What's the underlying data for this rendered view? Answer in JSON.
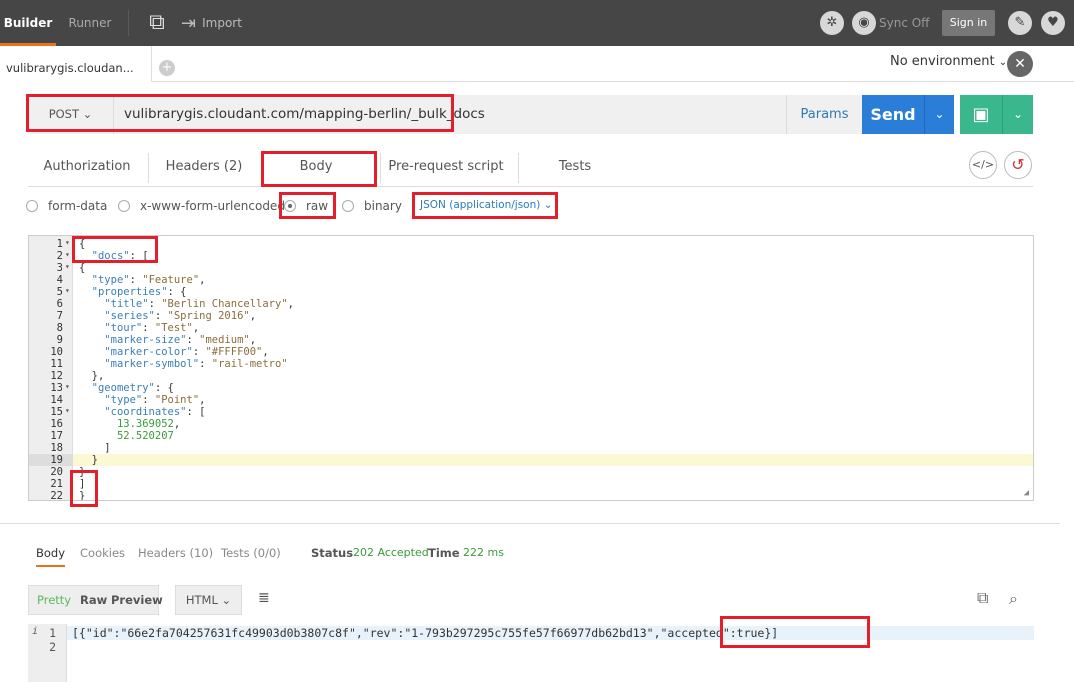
{
  "topbar": {
    "builder": "Builder",
    "runner": "Runner",
    "import": "Import",
    "sync": "Sync Off",
    "signin": "Sign in"
  },
  "tab": {
    "title": "vulibrarygis.cloudan..."
  },
  "environment": {
    "label": "No environment"
  },
  "request": {
    "method": "POST",
    "url": "vulibrarygis.cloudant.com/mapping-berlin/_bulk_docs",
    "params": "Params",
    "send": "Send"
  },
  "subtabs": [
    "Authorization",
    "Headers (2)",
    "Body",
    "Pre-request script",
    "Tests"
  ],
  "body_options": {
    "form_data": "form-data",
    "urlencoded": "x-www-form-urlencoded",
    "raw": "raw",
    "binary": "binary",
    "content_type": "JSON (application/json)"
  },
  "editor_lines": [
    "{",
    "  \"docs\": [",
    "{",
    "  \"type\": \"Feature\",",
    "  \"properties\": {",
    "    \"title\": \"Berlin Chancellary\",",
    "    \"series\": \"Spring 2016\",",
    "    \"tour\": \"Test\",",
    "    \"marker-size\": \"medium\",",
    "    \"marker-color\": \"#FFFF00\",",
    "    \"marker-symbol\": \"rail-metro\"",
    "  },",
    "  \"geometry\": {",
    "    \"type\": \"Point\",",
    "    \"coordinates\": [",
    "      13.369052,",
    "      52.520207",
    "    ]",
    "  }",
    "}",
    "]",
    "}"
  ],
  "response": {
    "tabs": {
      "body": "Body",
      "cookies": "Cookies",
      "headers": "Headers (10)",
      "tests": "Tests (0/0)"
    },
    "status_label": "Status",
    "status_value": "202 Accepted",
    "time_label": "Time",
    "time_value": "222 ms",
    "formats": {
      "pretty": "Pretty",
      "raw": "Raw",
      "preview": "Preview"
    },
    "language": "HTML",
    "line1": "[{\"id\":\"66e2fa704257631fc49903d0b3807c8f\",\"rev\":\"1-793b297295c755fe57f66977db62bd13\",\"accepted\":true}]",
    "line_numbers": [
      "1",
      "2"
    ]
  },
  "colors": {
    "highlight": "#e21f2b",
    "send": "#2a7ed8",
    "save": "#3ab78d",
    "accent": "#e8731a"
  }
}
